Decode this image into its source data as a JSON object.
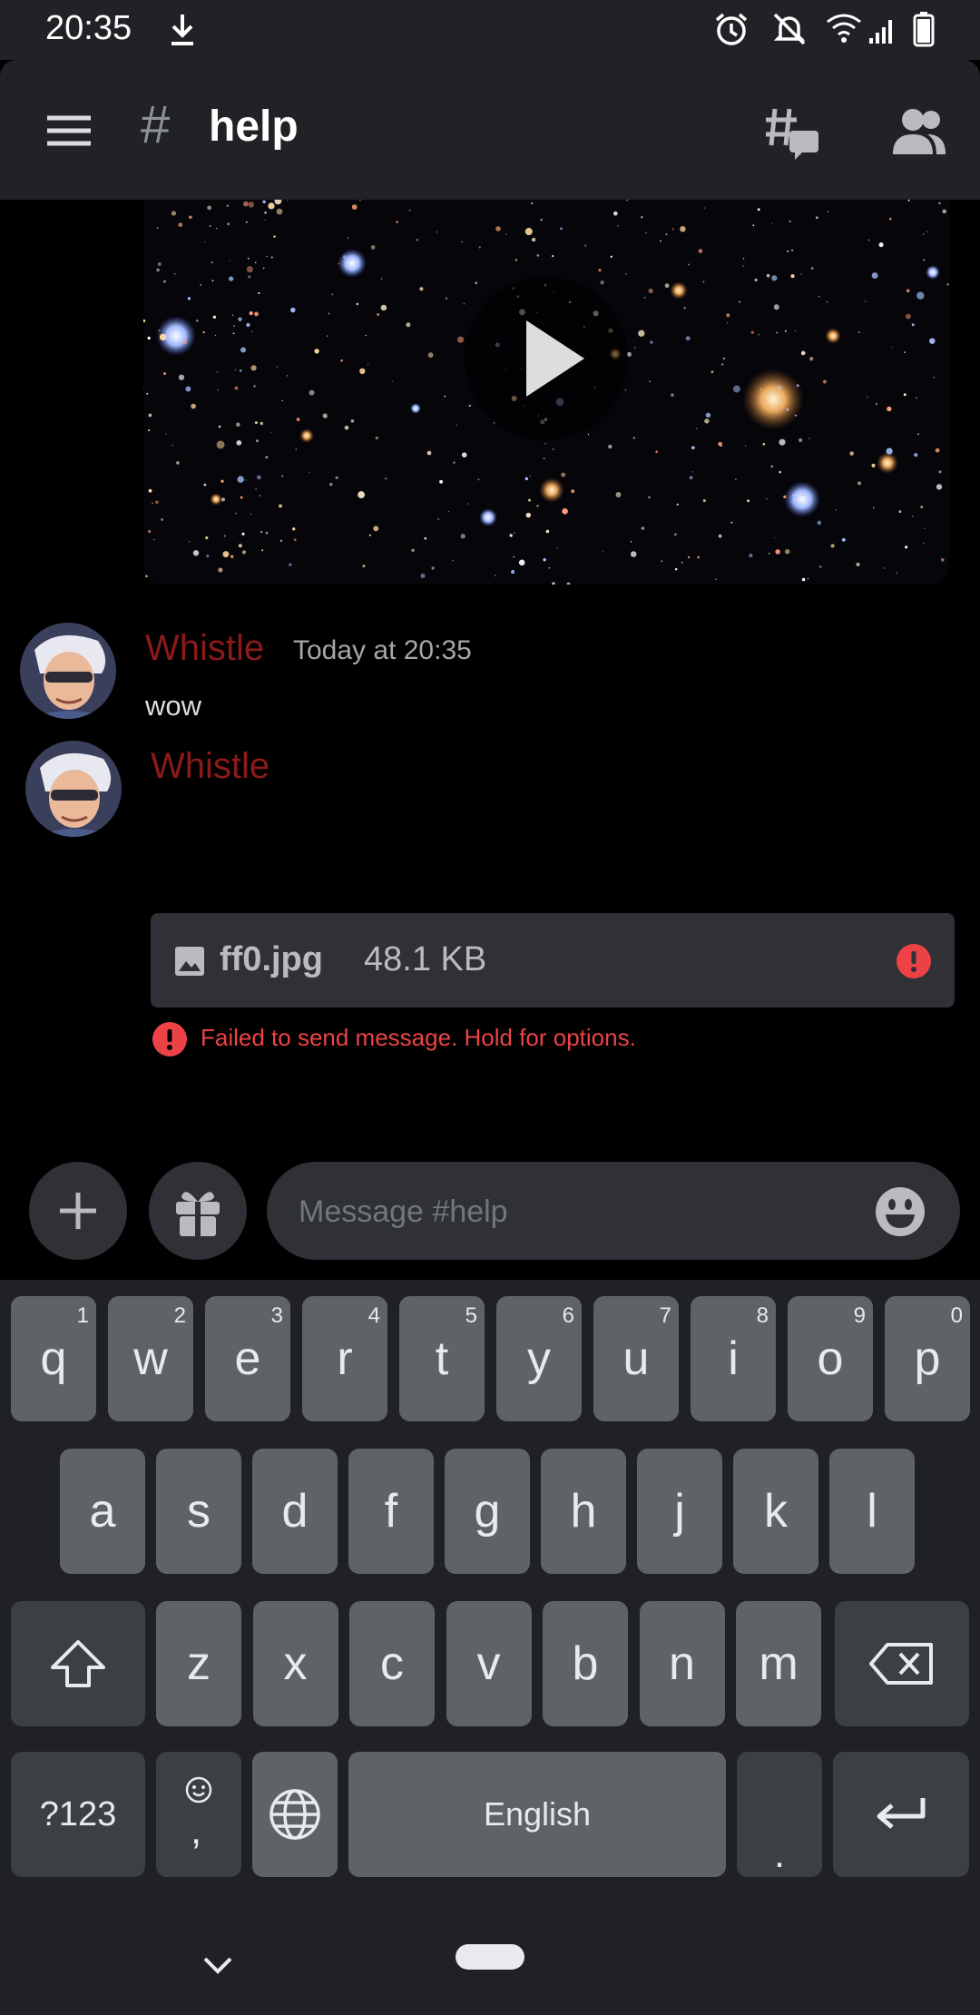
{
  "status_bar": {
    "time": "20:35"
  },
  "header": {
    "hash": "#",
    "channel": "help"
  },
  "messages": [
    {
      "username": "Whistle",
      "timestamp": "Today at 20:35",
      "text": "wow"
    },
    {
      "username": "Whistle"
    }
  ],
  "attachment": {
    "file_name": "ff0.jpg",
    "file_size": "48.1 KB"
  },
  "error": {
    "text": "Failed to send message. Hold for options."
  },
  "composer": {
    "placeholder": "Message #help"
  },
  "keyboard": {
    "row1": [
      {
        "label": "q",
        "hint": "1"
      },
      {
        "label": "w",
        "hint": "2"
      },
      {
        "label": "e",
        "hint": "3"
      },
      {
        "label": "r",
        "hint": "4"
      },
      {
        "label": "t",
        "hint": "5"
      },
      {
        "label": "y",
        "hint": "6"
      },
      {
        "label": "u",
        "hint": "7"
      },
      {
        "label": "i",
        "hint": "8"
      },
      {
        "label": "o",
        "hint": "9"
      },
      {
        "label": "p",
        "hint": "0"
      }
    ],
    "row2": [
      "a",
      "s",
      "d",
      "f",
      "g",
      "h",
      "j",
      "k",
      "l"
    ],
    "row3": [
      "z",
      "x",
      "c",
      "v",
      "b",
      "n",
      "m"
    ],
    "symbols_label": "?123",
    "comma_label": ",",
    "space_label": "English",
    "period_label": "."
  },
  "colors": {
    "username": "#8b1a1a",
    "error": "#ed4245",
    "background": "#000000",
    "header": "#202225"
  }
}
